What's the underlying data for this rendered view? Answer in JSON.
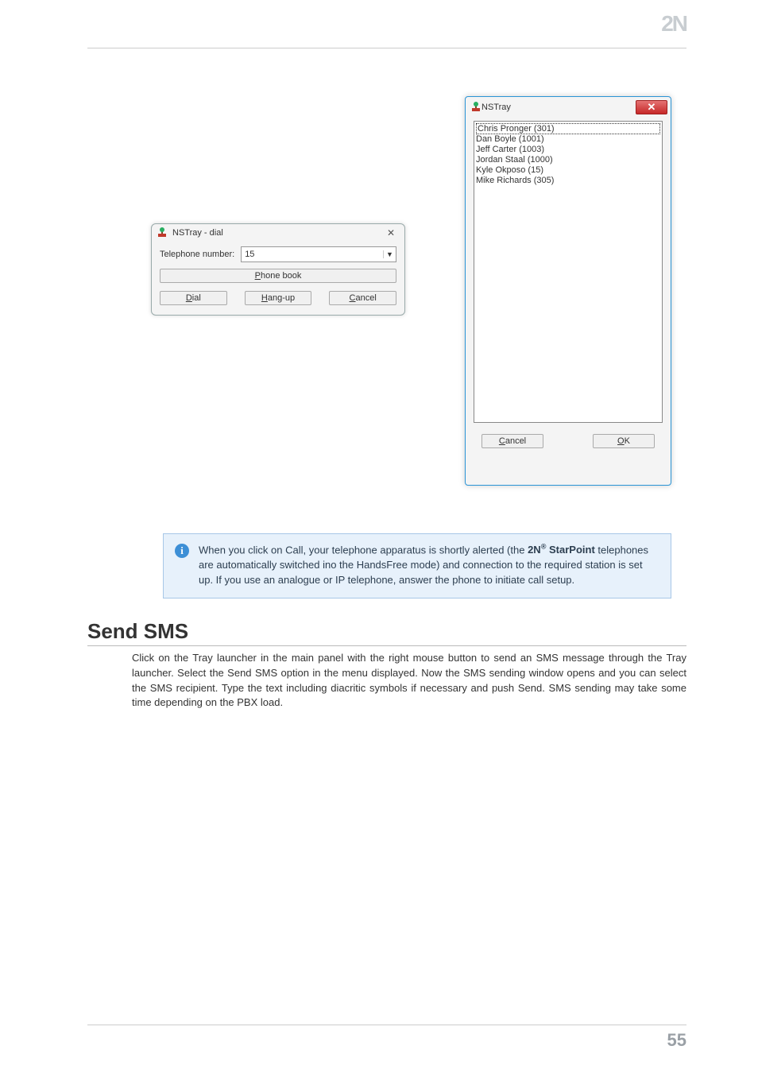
{
  "brand_logo": "2N",
  "dial_dialog": {
    "title": "NSTray - dial",
    "close_glyph": "✕",
    "tel_label": "Telephone number:",
    "tel_value": "15",
    "phonebook_btn": "Phone book",
    "dial_btn": "Dial",
    "hangup_btn": "Hang-up",
    "cancel_btn": "Cancel"
  },
  "phonebook_dialog": {
    "title": "NSTray",
    "close_glyph": "✕",
    "entries": [
      "Chris Pronger (301)",
      "Dan Boyle (1001)",
      "Jeff Carter (1003)",
      "Jordan Staal (1000)",
      "Kyle Okposo (15)",
      "Mike Richards (305)"
    ],
    "cancel_btn": "Cancel",
    "ok_btn": "OK"
  },
  "callout": {
    "text_pre": "When you click on Call, your telephone apparatus is shortly alerted (the ",
    "brand_prefix": "2N",
    "brand_suffix": " StarPoint",
    "text_post": " telephones are automatically switched ino the HandsFree mode) and connection to the required station is set up. If you use an analogue or IP telephone, answer the phone to initiate call setup."
  },
  "section_heading": "Send SMS",
  "section_body": "Click on the Tray launcher in the main panel with the right mouse button to send an SMS message through the Tray launcher. Select the Send SMS option in the menu displayed. Now the SMS sending window opens and you can select the SMS recipient. Type the text including diacritic symbols if necessary and push Send. SMS sending may take some time depending on the PBX load.",
  "page_number": "55"
}
